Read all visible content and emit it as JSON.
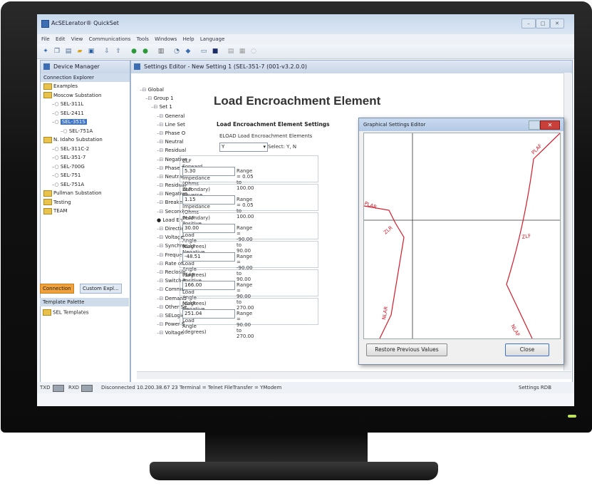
{
  "app": {
    "title": "AcSELerator® QuickSet"
  },
  "menu": [
    "File",
    "Edit",
    "View",
    "Communications",
    "Tools",
    "Windows",
    "Help",
    "Language"
  ],
  "device_manager": {
    "title": "Device Manager",
    "subheader": "Connection Explorer",
    "tree": [
      {
        "label": "Examples",
        "level": 0,
        "type": "folder"
      },
      {
        "label": "Moscow Substation",
        "level": 0,
        "type": "folder"
      },
      {
        "label": "SEL-311L",
        "level": 1,
        "type": "device"
      },
      {
        "label": "SEL-2411",
        "level": 1,
        "type": "device"
      },
      {
        "label": "SEL-351S",
        "level": 1,
        "type": "device",
        "selected": true
      },
      {
        "label": "SEL-751A",
        "level": 2,
        "type": "device"
      },
      {
        "label": "N. Idaho Substation",
        "level": 0,
        "type": "folder"
      },
      {
        "label": "SEL-311C-2",
        "level": 1,
        "type": "device"
      },
      {
        "label": "SEL-351-7",
        "level": 1,
        "type": "device"
      },
      {
        "label": "SEL-700G",
        "level": 1,
        "type": "device"
      },
      {
        "label": "SEL-751",
        "level": 1,
        "type": "device"
      },
      {
        "label": "SEL-751A",
        "level": 1,
        "type": "device"
      },
      {
        "label": "Pullman Substation",
        "level": 0,
        "type": "folder"
      },
      {
        "label": "Testing",
        "level": 0,
        "type": "folder"
      },
      {
        "label": "TEAM",
        "level": 0,
        "type": "folder"
      }
    ],
    "tabs": [
      "Connection",
      "Custom Expl..."
    ],
    "template_header": "Template Palette",
    "template_item": "SEL Templates"
  },
  "settings_editor": {
    "title": "Settings Editor - New Setting 1 (SEL-351-7 (001-v3.2.0.0)",
    "tree": [
      "Global",
      "Group 1",
      "Set 1",
      "General",
      "Line Set",
      "Phase O",
      "Neutral",
      "Residual",
      "Negative",
      "Phase T",
      "Neutral",
      "Residual",
      "Negative",
      "Breaker",
      "Second",
      "Load En",
      "Direction",
      "Voltage",
      "Synchro",
      "Frequen",
      "Rate of",
      "Reclosin",
      "Switch-o",
      "Commun",
      "Demand",
      "Other Se",
      "SELogic",
      "Power E",
      "Voltage"
    ],
    "heading": "Load Encroachment Element",
    "section": "Load Encroachment Element Settings",
    "eload_label": "ELOAD  Load Encroachment Elements",
    "eload_value": "Y",
    "eload_select": "Select: Y, N",
    "fields": [
      {
        "label": "ZLF  Forward Load Impedance (Ohms secondary)",
        "value": "5.30",
        "range": "Range = 0.05 to 100.00"
      },
      {
        "label": "ZLR  Reverse Load Impedance (Ohms secondary)",
        "value": "1.15",
        "range": "Range = 0.05 to 100.00"
      },
      {
        "label": "PLAF  Positive Forward Load Angle (degrees)",
        "value": "30.00",
        "range": "Range = -90.00 to 90.00"
      },
      {
        "label": "NLAF  Negative Forward Load Angle (degrees)",
        "value": "-48.51",
        "range": "Range = -90.00 to 90.00"
      },
      {
        "label": "PLAR  Positive Reverse Load Angle (degrees)",
        "value": "166.00",
        "range": "Range = 90.00 to 270.00"
      },
      {
        "label": "NLAR  Negative Reverse Load Angle (degrees)",
        "value": "251.04",
        "range": "Range = 90.00 to 270.00"
      }
    ]
  },
  "graphical_editor": {
    "title": "Graphical Settings Editor",
    "labels": {
      "plaf": "PLAF",
      "plar": "PLAR",
      "zlr": "ZLR",
      "zlf": "ZLF",
      "nlar": "NLAR",
      "nlaf": "NLAF"
    },
    "restore_button": "Restore Previous Values",
    "close_button": "Close"
  },
  "status": {
    "tx": "TXD",
    "rx": "RXD",
    "text": "Disconnected  10.200.38.67 23   Terminal = Telnet  FileTransfer = YModem",
    "right": "Settings RDB"
  },
  "colors": {
    "curve": "#d61a2a",
    "accent": "#3b73c9"
  }
}
